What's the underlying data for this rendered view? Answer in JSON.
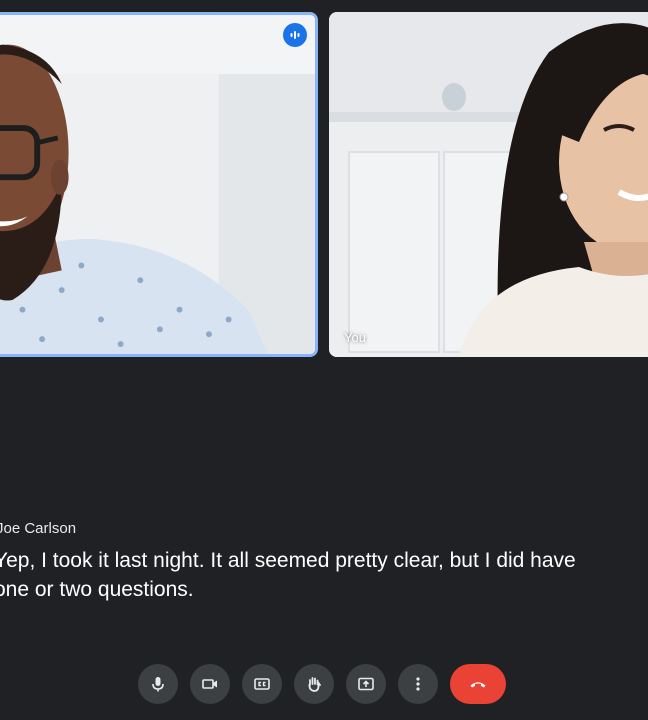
{
  "participants": [
    {
      "name": "Joe Carlson",
      "label": "",
      "speaking": true
    },
    {
      "name": "You",
      "label": "You",
      "speaking": false
    }
  ],
  "caption": {
    "speaker": "Joe Carlson",
    "text": "Yep, I took it last night. It all seemed pretty clear, but I did have\none or two questions."
  },
  "controls": [
    {
      "name": "microphone",
      "icon": "mic-icon"
    },
    {
      "name": "camera",
      "icon": "videocam-icon"
    },
    {
      "name": "captions",
      "icon": "closed-caption-icon"
    },
    {
      "name": "raise-hand",
      "icon": "hand-icon"
    },
    {
      "name": "present",
      "icon": "present-to-all-icon"
    },
    {
      "name": "more-options",
      "icon": "more-vert-icon"
    },
    {
      "name": "leave-call",
      "icon": "call-end-icon"
    }
  ],
  "colors": {
    "background": "#202124",
    "speaking_border": "#8ab4f8",
    "speaking_badge": "#1a73e8",
    "button": "#3c4043",
    "end_call": "#ea4335"
  }
}
